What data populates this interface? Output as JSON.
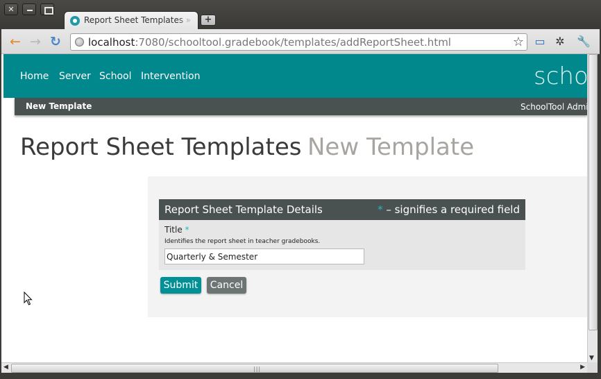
{
  "browser": {
    "tab_title": "Report Sheet Templates » SchoolTool",
    "new_tab_symbol": "+",
    "url_host": "localhost",
    "url_rest": ":7080/schooltool.gradebook/templates/addReportSheet.html",
    "window_buttons": {
      "close": "✕",
      "minimize": "",
      "maximize": ""
    },
    "icons": {
      "back": "back-arrow-icon",
      "forward": "forward-arrow-icon",
      "reload": "reload-icon",
      "site": "globe-icon",
      "bookmark": "star-icon",
      "fullscreen": "fullscreen-icon",
      "pin": "pin-icon",
      "wrench": "wrench-icon"
    }
  },
  "nav": {
    "items": [
      "Home",
      "Server",
      "School",
      "Intervention"
    ],
    "brand": "schoolt"
  },
  "subnav": {
    "left": "New Template",
    "right": "SchoolTool Administrator"
  },
  "page": {
    "title": "Report Sheet Templates",
    "subtitle": "New Template"
  },
  "form": {
    "legend": "Report Sheet Template Details",
    "required_asterisk": "*",
    "required_note": "– signifies a required field",
    "title_label": "Title",
    "title_hint": "Identifies the report sheet in teacher gradebooks.",
    "title_value": "Quarterly & Semester",
    "submit_label": "Submit",
    "cancel_label": "Cancel"
  },
  "colors": {
    "nav_bg": "#00888c",
    "subnav_bg": "#4a5151",
    "submit_bg": "#009095",
    "cancel_bg": "#6c7474",
    "accent_asterisk": "#22b8c0"
  }
}
